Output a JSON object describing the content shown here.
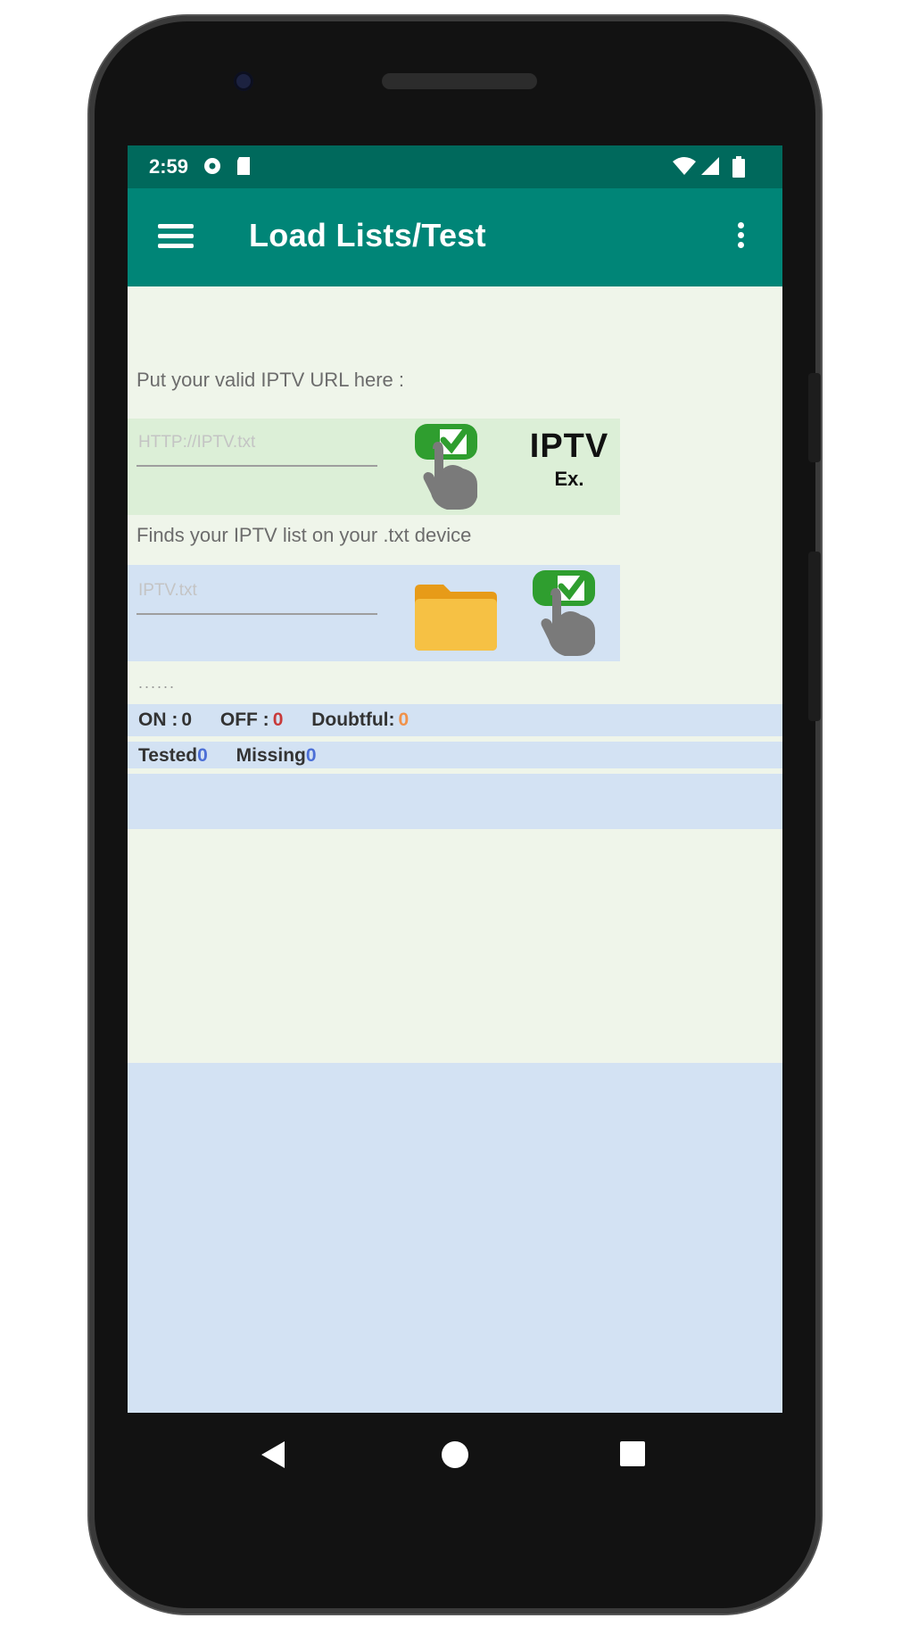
{
  "status_bar": {
    "time": "2:59",
    "icons": [
      "gear-notification-icon",
      "sd-card-icon",
      "wifi-icon",
      "signal-icon",
      "battery-icon"
    ]
  },
  "app_bar": {
    "title": "Load Lists/Test",
    "menu_icon": "hamburger-menu-icon",
    "overflow_icon": "overflow-menu-icon",
    "background": "#008577",
    "status_background": "#00695c"
  },
  "url_section": {
    "label": "Put your valid IPTV URL here :",
    "placeholder": "HTTP://IPTV.txt",
    "check_icon": "check-tap-icon",
    "logo_text": "IPTV",
    "logo_subtext": "Ex."
  },
  "file_section": {
    "label": "Finds your IPTV list on your .txt device",
    "placeholder": "IPTV.txt",
    "folder_icon": "folder-icon",
    "check_icon": "check-tap-icon"
  },
  "divider_text": "......",
  "stats": {
    "on_label": "ON :",
    "on_value": "0",
    "off_label": "OFF :",
    "off_value": "0",
    "doubtful_label": "Doubtful:",
    "doubtful_value": "0",
    "tested_label": "Tested",
    "tested_value": "0",
    "missing_label": "Missing",
    "missing_value": "0"
  },
  "nav_bar": {
    "back_icon": "back-triangle-icon",
    "home_icon": "home-circle-icon",
    "recents_icon": "recents-square-icon"
  }
}
